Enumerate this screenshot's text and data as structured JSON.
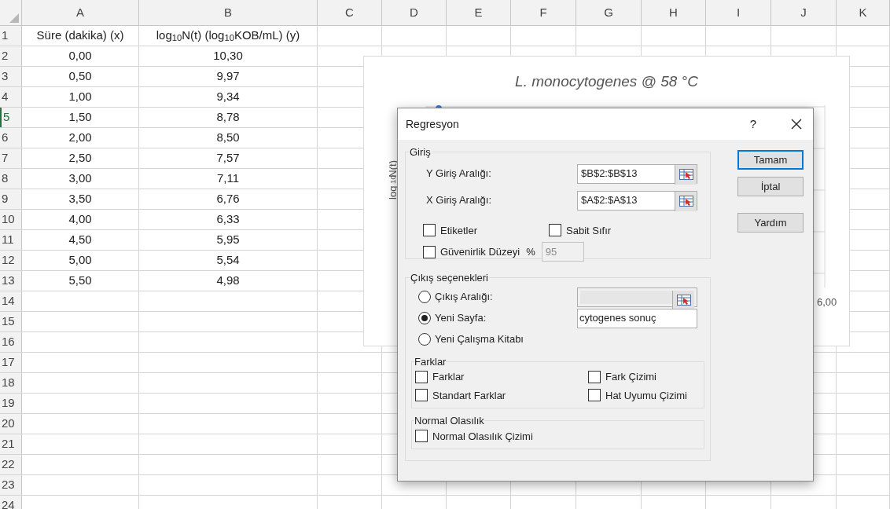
{
  "sheet": {
    "column_headers": [
      "A",
      "B",
      "C",
      "D",
      "E",
      "F",
      "G",
      "H",
      "I",
      "J",
      "K"
    ],
    "rows": [
      {
        "number": "1",
        "cells": [
          "Süre (dakika)  (x)",
          "log$_{10}$N(t) (log$_{10}$KOB/mL) (y)"
        ],
        "selected": false
      },
      {
        "number": "2",
        "cells": [
          "0,00",
          "10,30"
        ],
        "selected": false
      },
      {
        "number": "3",
        "cells": [
          "0,50",
          "9,97"
        ],
        "selected": false
      },
      {
        "number": "4",
        "cells": [
          "1,00",
          "9,34"
        ],
        "selected": false
      },
      {
        "number": "5",
        "cells": [
          "1,50",
          "8,78"
        ],
        "selected": true
      },
      {
        "number": "6",
        "cells": [
          "2,00",
          "8,50"
        ],
        "selected": false
      },
      {
        "number": "7",
        "cells": [
          "2,50",
          "7,57"
        ],
        "selected": false
      },
      {
        "number": "8",
        "cells": [
          "3,00",
          "7,11"
        ],
        "selected": false
      },
      {
        "number": "9",
        "cells": [
          "3,50",
          "6,76"
        ],
        "selected": false
      },
      {
        "number": "10",
        "cells": [
          "4,00",
          "6,33"
        ],
        "selected": false
      },
      {
        "number": "11",
        "cells": [
          "4,50",
          "5,95"
        ],
        "selected": false
      },
      {
        "number": "12",
        "cells": [
          "5,00",
          "5,54"
        ],
        "selected": false
      },
      {
        "number": "13",
        "cells": [
          "5,50",
          "4,98"
        ],
        "selected": false
      },
      {
        "number": "14",
        "selected": false
      },
      {
        "number": "15",
        "selected": false
      },
      {
        "number": "16",
        "selected": false
      },
      {
        "number": "17",
        "selected": false
      },
      {
        "number": "18",
        "selected": false
      },
      {
        "number": "19",
        "selected": false
      },
      {
        "number": "20",
        "selected": false
      },
      {
        "number": "21",
        "selected": false
      },
      {
        "number": "22",
        "selected": false
      },
      {
        "number": "23",
        "selected": false
      },
      {
        "number": "24",
        "selected": false
      }
    ]
  },
  "chart": {
    "title": "L. monocytogenes @ 58 °C",
    "ylabel": "log$_{10}$N(t)",
    "tick_label": "6,00"
  },
  "dialog": {
    "title": "Regresyon",
    "help": "?",
    "input_group": {
      "legend": "Giriş",
      "fields": [
        {
          "label": "Y Giriş Aralığı:",
          "value": "$B$2:$B$13"
        },
        {
          "label": "X Giriş Aralığı:",
          "value": "$A$2:$A$13"
        }
      ],
      "checkboxes": [
        {
          "label": "Etiketler",
          "checked": false
        },
        {
          "label": "Sabit Sıfır",
          "checked": false
        }
      ],
      "confidence": {
        "label": "Güvenirlik Düzeyi",
        "checked": false,
        "percent": "%",
        "value": "95",
        "disabled": true
      }
    },
    "output_group": {
      "legend": "Çıkış seçenekleri",
      "options": [
        {
          "label": "Çıkış Aralığı:",
          "selected": false,
          "field": {
            "disabled": true,
            "picker": true
          }
        },
        {
          "label": "Yeni Sayfa:",
          "selected": true,
          "field": {
            "value": "cytogenes sonuç",
            "disabled": false,
            "picker": false
          }
        },
        {
          "label": "Yeni Çalışma Kitabı",
          "selected": false
        }
      ],
      "subgroups": [
        {
          "legend": "Farklar",
          "checkboxes": [
            {
              "label": "Farklar",
              "checked": false
            },
            {
              "label": "Fark Çizimi",
              "checked": false
            },
            {
              "label": "Standart Farklar",
              "checked": false
            },
            {
              "label": "Hat Uyumu Çizimi",
              "checked": false
            }
          ]
        },
        {
          "legend": "Normal Olasılık",
          "checkboxes": [
            {
              "label": "Normal Olasılık Çizimi",
              "checked": false
            }
          ]
        }
      ]
    },
    "buttons": [
      {
        "label": "Tamam",
        "default": true
      },
      {
        "label": "İptal",
        "default": false
      },
      {
        "label": "Yardım",
        "default": false
      }
    ]
  }
}
